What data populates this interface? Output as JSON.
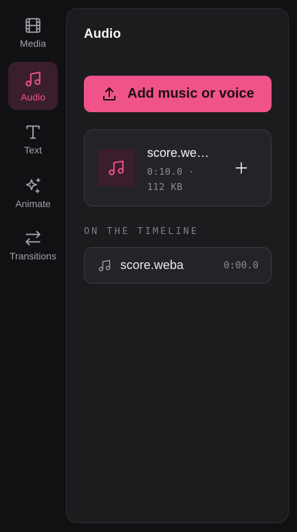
{
  "rail": {
    "items": [
      {
        "label": "Media",
        "icon": "film-icon"
      },
      {
        "label": "Audio",
        "icon": "music-note-icon"
      },
      {
        "label": "Text",
        "icon": "text-icon"
      },
      {
        "label": "Animate",
        "icon": "sparkles-icon"
      },
      {
        "label": "Transitions",
        "icon": "arrows-left-right-icon"
      }
    ],
    "active": "Audio"
  },
  "panel": {
    "title": "Audio",
    "add_button_label": "Add music or voice",
    "asset": {
      "name": "score.we…",
      "duration": "0:10.0 ·",
      "size": "112 KB"
    },
    "section_heading": "ON THE TIMELINE",
    "timeline_items": [
      {
        "name": "score.weba",
        "time": "0:00.0"
      }
    ]
  },
  "colors": {
    "accent": "#f0538a",
    "background": "#111113",
    "panel": "#1c1c1f",
    "card": "#242428"
  }
}
